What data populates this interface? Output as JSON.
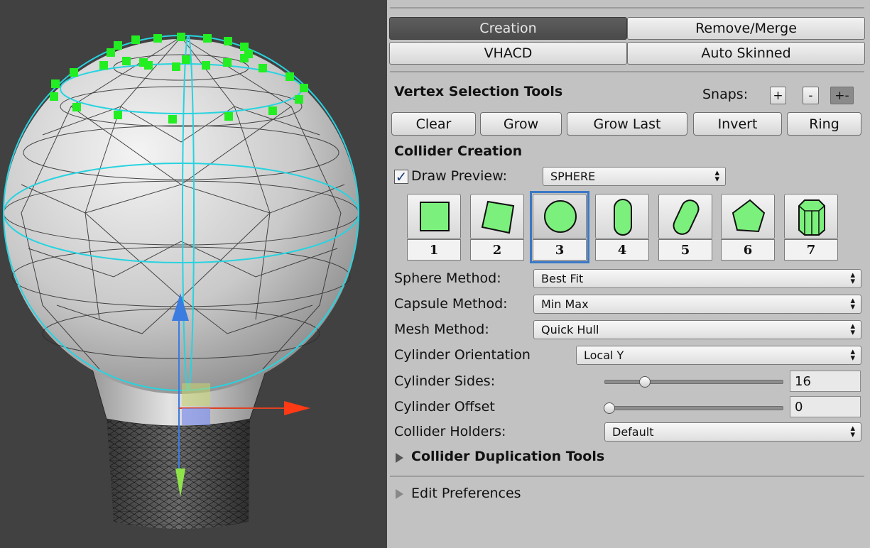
{
  "tabs": [
    {
      "label": "Creation",
      "active": true
    },
    {
      "label": "Remove/Merge",
      "active": false
    },
    {
      "label": "VHACD",
      "active": false
    },
    {
      "label": "Auto Skinned",
      "active": false
    }
  ],
  "vertex_tools": {
    "title": "Vertex Selection Tools",
    "snaps_label": "Snaps:",
    "snap_plus": "+",
    "snap_minus": "-",
    "snap_both": "+-",
    "buttons": [
      "Clear",
      "Grow",
      "Grow Last",
      "Invert",
      "Ring"
    ]
  },
  "collider_creation": {
    "title": "Collider Creation",
    "draw_preview_label": "Draw Preview:",
    "draw_preview_checked": true,
    "preview_value": "SPHERE",
    "shape_numbers": [
      "1",
      "2",
      "3",
      "4",
      "5",
      "6",
      "7"
    ],
    "shape_icons": [
      "box-icon",
      "rotated-box-icon",
      "sphere-icon",
      "capsule-icon",
      "rotated-capsule-icon",
      "convex-mesh-icon",
      "cylinder-icon"
    ],
    "selected_shape": 3,
    "shape_fill": "#7cf07c"
  },
  "settings": {
    "sphere_method_label": "Sphere Method:",
    "sphere_method_value": "Best Fit",
    "capsule_method_label": "Capsule Method:",
    "capsule_method_value": "Min Max",
    "mesh_method_label": "Mesh Method:",
    "mesh_method_value": "Quick Hull",
    "cylinder_orientation_label": "Cylinder Orientation",
    "cylinder_orientation_value": "Local Y",
    "cylinder_sides_label": "Cylinder Sides:",
    "cylinder_sides_value": "16",
    "cylinder_offset_label": "Cylinder Offset",
    "cylinder_offset_value": "0",
    "collider_holders_label": "Collider Holders:",
    "collider_holders_value": "Default"
  },
  "sections": {
    "duplication_title": "Collider Duplication Tools",
    "edit_prefs_title": "Edit Preferences"
  },
  "colors": {
    "viewport_bg": "#414141",
    "panel_bg": "#c2c2c2",
    "vertex_green": "#22ee22",
    "wire_cyan": "#27d3e0",
    "selection_blue": "#3b78c6"
  }
}
